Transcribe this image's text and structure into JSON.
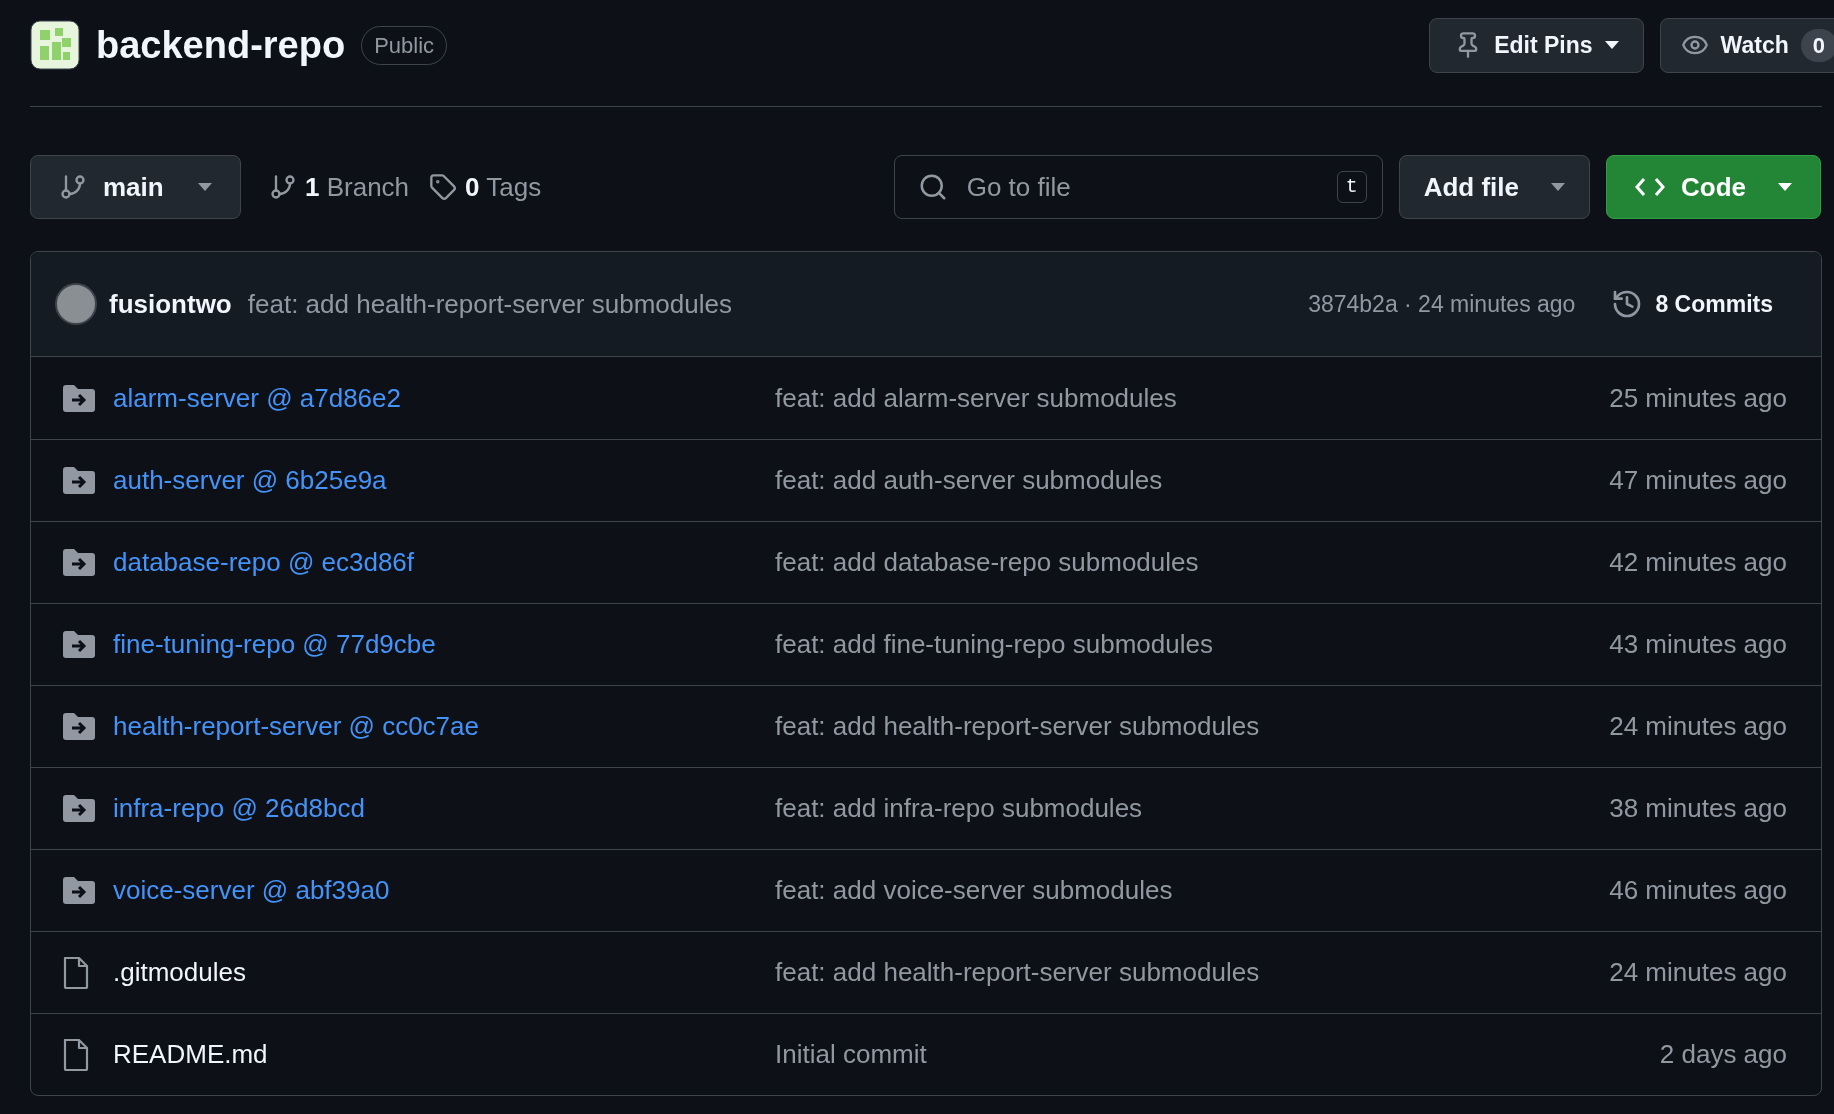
{
  "repo": {
    "name": "backend-repo",
    "visibility": "Public"
  },
  "header_actions": {
    "edit_pins": "Edit Pins",
    "watch": "Watch",
    "watch_count": "0"
  },
  "toolbar": {
    "branch": "main",
    "branches_count": "1",
    "branches_label": "Branch",
    "tags_count": "0",
    "tags_label": "Tags",
    "search": {
      "placeholder": "Go to file",
      "shortcut": "t"
    },
    "add_file": "Add file",
    "code": "Code"
  },
  "latest_commit": {
    "author": "fusiontwo",
    "message": "feat: add health-report-server submodules",
    "hash_time": "3874b2a · 24 minutes ago",
    "commits_count": "8",
    "commits_label": "Commits"
  },
  "files": [
    {
      "kind": "submodule",
      "name": "alarm-server @ a7d86e2",
      "message": "feat: add alarm-server submodules",
      "time": "25 minutes ago"
    },
    {
      "kind": "submodule",
      "name": "auth-server @ 6b25e9a",
      "message": "feat: add auth-server submodules",
      "time": "47 minutes ago"
    },
    {
      "kind": "submodule",
      "name": "database-repo @ ec3d86f",
      "message": "feat: add database-repo submodules",
      "time": "42 minutes ago"
    },
    {
      "kind": "submodule",
      "name": "fine-tuning-repo @ 77d9cbe",
      "message": "feat: add fine-tuning-repo submodules",
      "time": "43 minutes ago"
    },
    {
      "kind": "submodule",
      "name": "health-report-server @ cc0c7ae",
      "message": "feat: add health-report-server submodules",
      "time": "24 minutes ago"
    },
    {
      "kind": "submodule",
      "name": "infra-repo @ 26d8bcd",
      "message": "feat: add infra-repo submodules",
      "time": "38 minutes ago"
    },
    {
      "kind": "submodule",
      "name": "voice-server @ abf39a0",
      "message": "feat: add voice-server submodules",
      "time": "46 minutes ago"
    },
    {
      "kind": "file",
      "name": ".gitmodules",
      "message": "feat: add health-report-server submodules",
      "time": "24 minutes ago"
    },
    {
      "kind": "file",
      "name": "README.md",
      "message": "Initial commit",
      "time": "2 days ago"
    }
  ]
}
